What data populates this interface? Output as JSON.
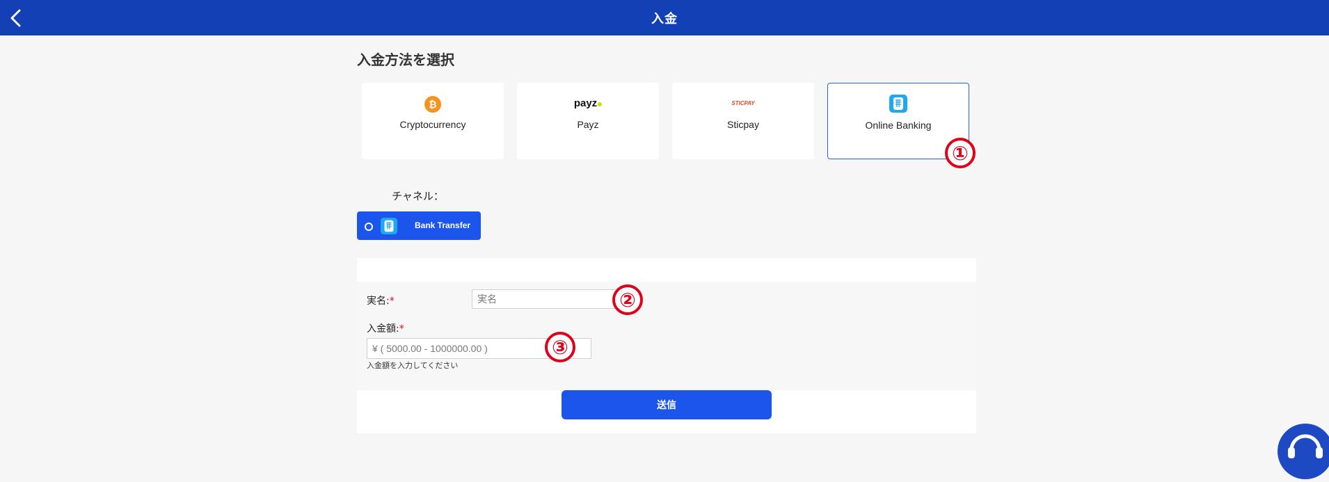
{
  "header": {
    "title": "入金",
    "back_icon": "chevron-left-icon"
  },
  "section": {
    "title": "入金方法を選択"
  },
  "methods": [
    {
      "label": "Cryptocurrency",
      "icon": "bitcoin-icon",
      "selected": false
    },
    {
      "label": "Payz",
      "icon": "payz-logo",
      "logo_text": "payz",
      "selected": false
    },
    {
      "label": "Sticpay",
      "icon": "sticpay-logo",
      "logo_text": "STICPAY",
      "selected": false
    },
    {
      "label": "Online Banking",
      "icon": "online-banking-icon",
      "selected": true
    }
  ],
  "annotations": [
    "①",
    "②",
    "③"
  ],
  "channel": {
    "label": "チャネル：",
    "option_label": "Bank Transfer",
    "icon": "bank-transfer-icon"
  },
  "form": {
    "name_label": "実名:",
    "name_placeholder": "実名",
    "amount_label": "入金額:",
    "amount_placeholder": "¥ ( 5000.00 - 1000000.00 )",
    "amount_hint": "入金額を入力してください",
    "required_mark": "*"
  },
  "submit": {
    "label": "送信"
  },
  "colors": {
    "header": "#1440b5",
    "primary": "#1b55ec",
    "accent_red": "#e0001a",
    "bitcoin": "#f7931a"
  }
}
